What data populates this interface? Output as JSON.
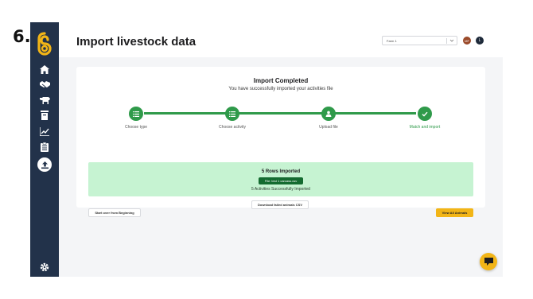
{
  "step_number": "6.",
  "header": {
    "title": "Import livestock data",
    "farm_select": "Farm 1",
    "avatar_initials": "MF",
    "user_initial": "L"
  },
  "sidebar": {
    "items": [
      {
        "icon": "home-icon"
      },
      {
        "icon": "handshake-icon"
      },
      {
        "icon": "cow-icon"
      },
      {
        "icon": "bin-icon"
      },
      {
        "icon": "chart-icon"
      },
      {
        "icon": "clipboard-icon"
      },
      {
        "icon": "upload-icon",
        "active": true
      }
    ],
    "footer_icon": "gear-icon"
  },
  "card": {
    "title": "Import Completed",
    "subtitle": "You have successfully imported your activities file"
  },
  "stepper": {
    "steps": [
      {
        "label": "Choose type",
        "icon": "list-icon"
      },
      {
        "label": "Choose activity",
        "icon": "list-icon"
      },
      {
        "label": "Upload file",
        "icon": "user-icon"
      },
      {
        "label": "Match and import",
        "icon": "check-icon"
      }
    ]
  },
  "result": {
    "title": "5 Rows Imported",
    "file_label": "File: test 1 carcass.csv",
    "subtitle": "5 Activities Successfully Imported"
  },
  "actions": {
    "download_failed": "Download failed animals CSV",
    "start_over": "Start over from Beginning",
    "view_all": "View All Animals"
  },
  "colors": {
    "sidebar": "#22324a",
    "accent_green": "#2f9a4a",
    "success_bg": "#c6f3d2",
    "cta_yellow": "#f2b517"
  }
}
